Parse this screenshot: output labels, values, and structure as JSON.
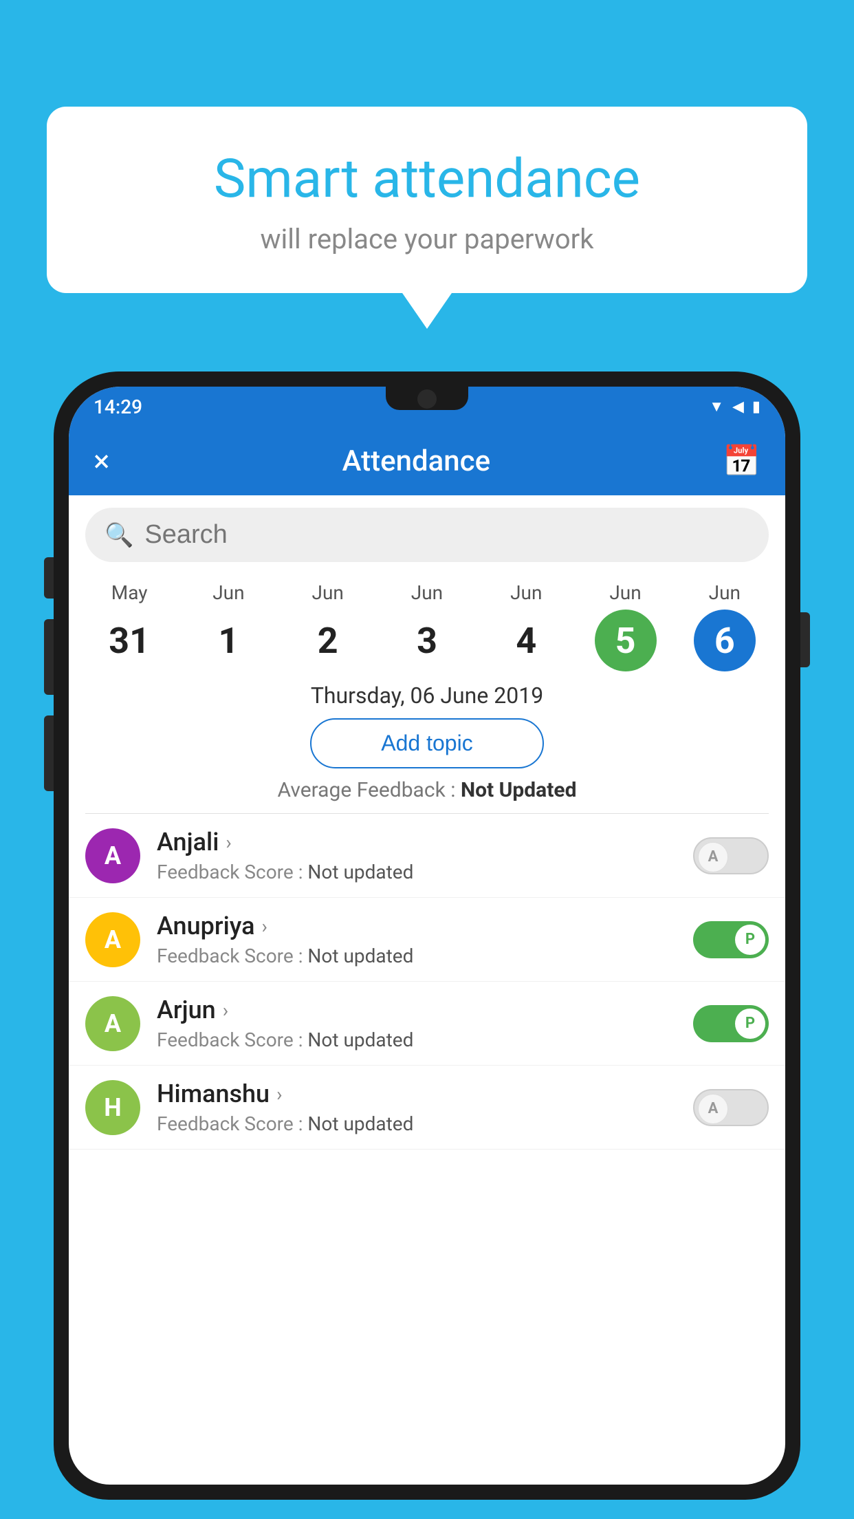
{
  "background_color": "#29b6e8",
  "speech_bubble": {
    "title": "Smart attendance",
    "subtitle": "will replace your paperwork"
  },
  "status_bar": {
    "time": "14:29",
    "icons": [
      "wifi",
      "signal",
      "battery"
    ]
  },
  "app_bar": {
    "title": "Attendance",
    "close_label": "×",
    "calendar_label": "📅"
  },
  "search": {
    "placeholder": "Search"
  },
  "calendar": {
    "days": [
      {
        "month": "May",
        "date": "31",
        "style": "normal"
      },
      {
        "month": "Jun",
        "date": "1",
        "style": "normal"
      },
      {
        "month": "Jun",
        "date": "2",
        "style": "normal"
      },
      {
        "month": "Jun",
        "date": "3",
        "style": "normal"
      },
      {
        "month": "Jun",
        "date": "4",
        "style": "normal"
      },
      {
        "month": "Jun",
        "date": "5",
        "style": "today"
      },
      {
        "month": "Jun",
        "date": "6",
        "style": "selected"
      }
    ]
  },
  "selected_date": "Thursday, 06 June 2019",
  "add_topic_label": "Add topic",
  "average_feedback": {
    "label": "Average Feedback : ",
    "value": "Not Updated"
  },
  "students": [
    {
      "name": "Anjali",
      "avatar_letter": "A",
      "avatar_color": "#9c27b0",
      "feedback_label": "Feedback Score : ",
      "feedback_value": "Not updated",
      "toggle": "off",
      "toggle_label": "A"
    },
    {
      "name": "Anupriya",
      "avatar_letter": "A",
      "avatar_color": "#ffc107",
      "feedback_label": "Feedback Score : ",
      "feedback_value": "Not updated",
      "toggle": "on",
      "toggle_label": "P"
    },
    {
      "name": "Arjun",
      "avatar_letter": "A",
      "avatar_color": "#8bc34a",
      "feedback_label": "Feedback Score : ",
      "feedback_value": "Not updated",
      "toggle": "on",
      "toggle_label": "P"
    },
    {
      "name": "Himanshu",
      "avatar_letter": "H",
      "avatar_color": "#8bc34a",
      "feedback_label": "Feedback Score : ",
      "feedback_value": "Not updated",
      "toggle": "off",
      "toggle_label": "A"
    }
  ]
}
